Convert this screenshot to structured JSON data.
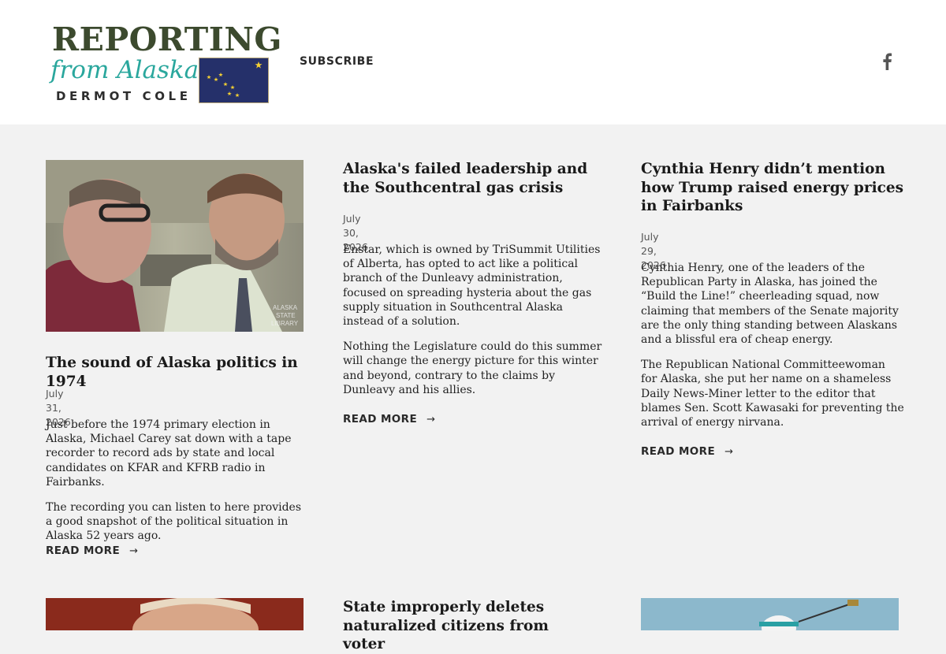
{
  "header": {
    "logo": {
      "title": "REPORTING",
      "subtitle": "from Alaska",
      "author": "DERMOT COLE",
      "title_color": "#3c4a2e",
      "subtitle_color": "#2aa79d",
      "flag_color": "#25306a",
      "star_color": "#f5d033"
    },
    "nav": {
      "subscribe_label": "SUBSCRIBE"
    },
    "social": {
      "icon": "facebook-icon"
    }
  },
  "posts": [
    {
      "title": "The sound of Alaska politics in 1974",
      "date": "July 31, 2026",
      "excerpt": [
        "Just before the 1974 primary election in Alaska, Michael Carey sat down with a tape recorder to record ads by state and local candidates on KFAR and KFRB radio in Fairbanks.",
        "The recording you can listen to here provides a good snapshot of the political situation in Alaska 52 years ago."
      ],
      "read_more": "READ MORE",
      "image_watermark": [
        "ALASKA",
        "STATE",
        "LIBRARY"
      ]
    },
    {
      "title": "Alaska's failed leadership and the Southcentral gas crisis",
      "date": "July 30, 2026",
      "excerpt": [
        "Enstar, which is owned by TriSummit Utilities of Alberta, has opted to act like a political branch of the Dunleavy administration, focused on spreading hysteria about the gas supply situation in Southcentral Alaska instead of a solution.",
        "Nothing the Legislature could do this summer will change the energy picture for this winter and beyond, contrary to the claims by Dunleavy and his allies."
      ],
      "read_more": "READ MORE"
    },
    {
      "title": "Cynthia Henry didn’t mention how Trump raised energy prices in Fairbanks",
      "date": "July 29, 2026",
      "excerpt": [
        "Cynthia Henry, one of the leaders of the Republican Party in Alaska, has joined the “Build the Line!” cheerleading squad, now claiming that members of the Senate majority are the only thing standing between Alaskans and a blissful era of cheap energy.",
        "The Republican National Committeewoman for Alaska, she put her name on a shameless Daily News-Miner letter to the editor that blames Sen. Scott Kawasaki for preventing the arrival of energy nirvana."
      ],
      "read_more": "READ MORE"
    },
    {
      "title": "State improperly deletes naturalized citizens from voter"
    }
  ],
  "arrow_glyph": "→"
}
